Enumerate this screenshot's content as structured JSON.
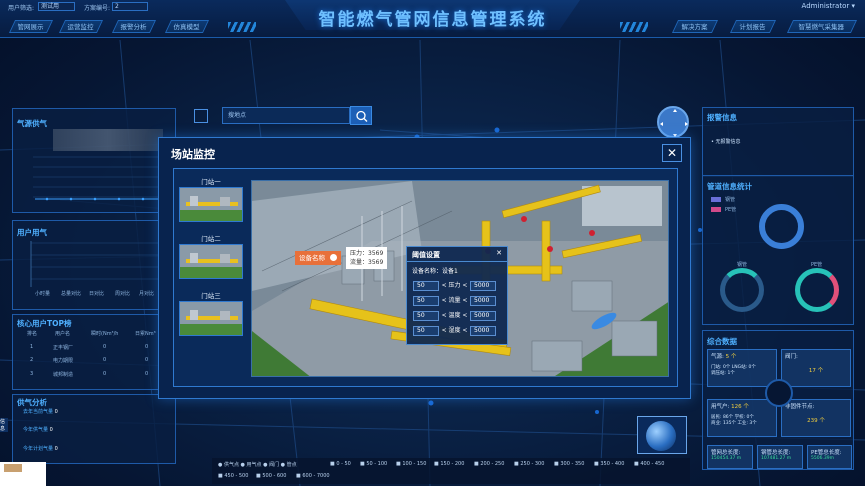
{
  "header": {
    "title": "智能燃气管网信息管理系统",
    "user_label": "用户筛选:",
    "user_value": "测试用",
    "code_label": "方案编号:",
    "code_value": "2",
    "account": "Administrator",
    "tabs_left": [
      "管网展示",
      "运营监控",
      "报警分析",
      "仿真模型"
    ],
    "tabs_right": [
      "解决方案",
      "计划报告",
      "智慧燃气采集器"
    ]
  },
  "left": {
    "supply_title": "气源供气",
    "user_gas_title": "用户用气",
    "user_gas_tabs": [
      "小时量",
      "总量对比",
      "日对比",
      "周对比",
      "月对比"
    ],
    "ptop_title": "核心用户TOP榜",
    "ptop_headers": [
      "排名",
      "用户名",
      "瞬时(Nm³/h",
      "日累Nm³"
    ],
    "ptop_rows": [
      {
        "rank": "1",
        "name": "正丰钢厂",
        "inst": "0",
        "daily": "0"
      },
      {
        "rank": "2",
        "name": "电力期限",
        "inst": "0",
        "daily": "0"
      },
      {
        "rank": "3",
        "name": "城邦制造",
        "inst": "0",
        "daily": "0"
      }
    ],
    "supply_analysis_title": "供气分析",
    "analysis_rows": [
      {
        "label": "去年当前气量",
        "value": "0"
      },
      {
        "label": "今年供气量",
        "value": "0"
      },
      {
        "label": "今年计划气量",
        "value": "0"
      }
    ],
    "side_tag": "信息"
  },
  "search": {
    "placeholder": "搜地点"
  },
  "modal": {
    "title": "场站监控",
    "close": "✕",
    "stations": [
      "门站一",
      "门站二",
      "门站三"
    ],
    "device_tag": "设备名称",
    "info_lines": [
      "压力：3569",
      "流量：3569"
    ],
    "threshold": {
      "title": "阈值设置",
      "device_label": "设备名称：",
      "device_value": "设备1",
      "close": "✕",
      "rows": [
        {
          "min": "50",
          "label": "< 压力 <",
          "max": "5000"
        },
        {
          "min": "50",
          "label": "< 流量 <",
          "max": "5000"
        },
        {
          "min": "50",
          "label": "< 温度 <",
          "max": "5000"
        },
        {
          "min": "50",
          "label": "< 湿度 <",
          "max": "5000"
        }
      ]
    }
  },
  "right": {
    "alarm_title": "报警信息",
    "alarm_item": "无报警信息",
    "pipe_title": "管道信息统计",
    "pipe_legend": [
      "钢管",
      "PE管"
    ],
    "ring_labels": [
      "钢管",
      "PE管"
    ],
    "overview_title": "综合数据",
    "gas_source": {
      "label": "气源:",
      "value": "5 个",
      "sub1": "门站: 0个  LNG站: 0个",
      "sub2": "调压站: 1个"
    },
    "valves": {
      "label": "阀门:",
      "value": "17 个"
    },
    "users": {
      "label": "用气户:",
      "value": "126 个",
      "sub1": "居民: 86个  学校: 0个",
      "sub2": "商业: 135个  工业: 3个"
    },
    "nonmember": {
      "label": "非固件节点:",
      "value": "239 个"
    },
    "lengths": [
      {
        "label": "管网总长度:",
        "value": "150454.37 m"
      },
      {
        "label": "钢管总长度:",
        "value": "107481.27 m"
      },
      {
        "label": "PE管总长度:",
        "value": "5506.39m"
      }
    ]
  },
  "map_legend": {
    "items1": [
      "供气点",
      "用气点",
      "阀门",
      "管点"
    ],
    "ranges": [
      "0 - 50",
      "50 - 100",
      "100 - 150",
      "150 - 200",
      "200 - 250",
      "250 - 300",
      "300 - 350",
      "350 - 400",
      "400 - 450",
      "450 - 500",
      "500 - 600",
      "600 - 7000"
    ]
  },
  "colors": {
    "accent": "#4fb0ff",
    "orange": "#e8703a",
    "yellow": "#f4d03f",
    "ring_blue": "#3a7fd8",
    "ring_teal": "#27c2b8"
  }
}
